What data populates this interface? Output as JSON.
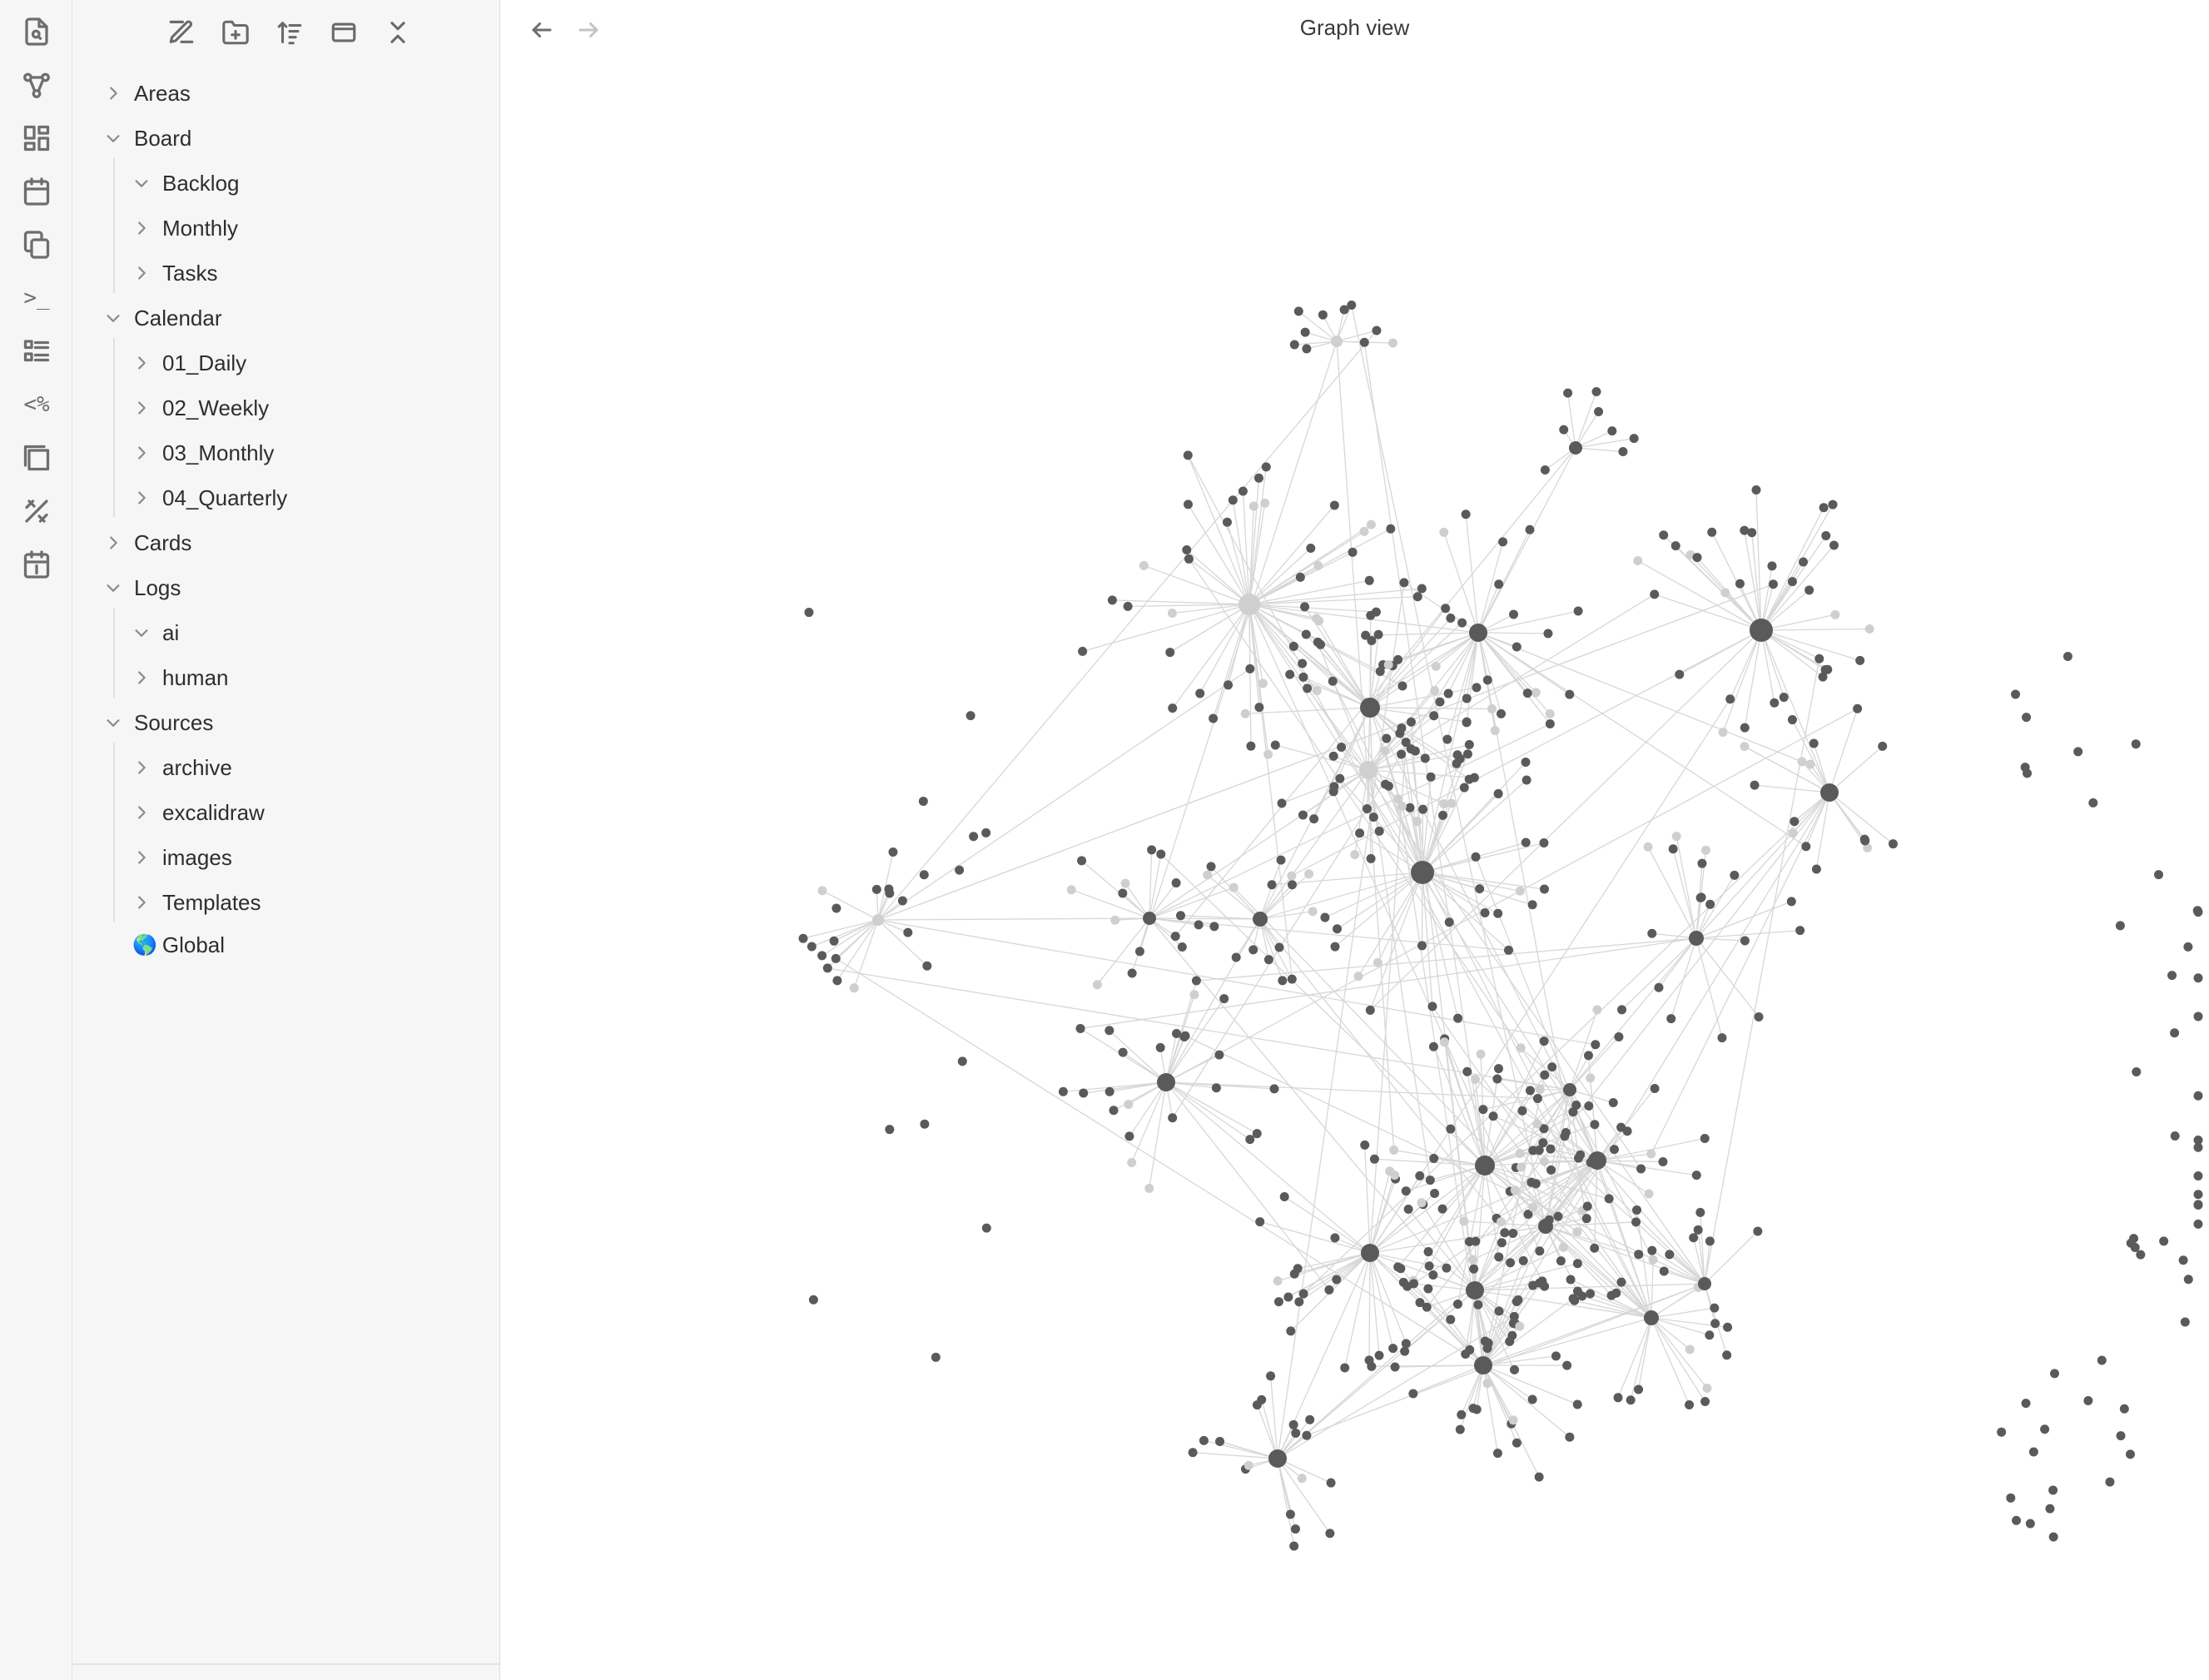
{
  "ribbon": {
    "icons": [
      "search-file-icon",
      "graph-icon",
      "dashboard-icon",
      "calendar-icon",
      "copy-icon",
      "terminal-icon",
      "list-icon",
      "templater-icon",
      "stack-icon",
      "excalidraw-icon",
      "daily-note-icon"
    ],
    "templater_glyph": "<%",
    "terminal_glyph": ">_"
  },
  "sidebar": {
    "toolbar": [
      "new-note-icon",
      "new-folder-icon",
      "sort-icon",
      "auto-reveal-icon",
      "collapse-all-icon"
    ],
    "tree": [
      {
        "label": "Areas",
        "expanded": false,
        "depth": 0
      },
      {
        "label": "Board",
        "expanded": true,
        "depth": 0
      },
      {
        "label": "Backlog",
        "expanded": true,
        "depth": 1
      },
      {
        "label": "Monthly",
        "expanded": false,
        "depth": 1
      },
      {
        "label": "Tasks",
        "expanded": false,
        "depth": 1
      },
      {
        "label": "Calendar",
        "expanded": true,
        "depth": 0
      },
      {
        "label": "01_Daily",
        "expanded": false,
        "depth": 1
      },
      {
        "label": "02_Weekly",
        "expanded": false,
        "depth": 1
      },
      {
        "label": "03_Monthly",
        "expanded": false,
        "depth": 1
      },
      {
        "label": "04_Quarterly",
        "expanded": false,
        "depth": 1
      },
      {
        "label": "Cards",
        "expanded": false,
        "depth": 0
      },
      {
        "label": "Logs",
        "expanded": true,
        "depth": 0
      },
      {
        "label": "ai",
        "expanded": true,
        "depth": 1
      },
      {
        "label": "human",
        "expanded": false,
        "depth": 1
      },
      {
        "label": "Sources",
        "expanded": true,
        "depth": 0
      },
      {
        "label": "archive",
        "expanded": false,
        "depth": 1
      },
      {
        "label": "excalidraw",
        "expanded": false,
        "depth": 1
      },
      {
        "label": "images",
        "expanded": false,
        "depth": 1
      },
      {
        "label": "Templates",
        "expanded": false,
        "depth": 1
      }
    ],
    "global_label": "Global",
    "global_emoji": "🌎"
  },
  "main": {
    "title": "Graph view",
    "back_icon": "arrow-left-icon",
    "forward_icon": "arrow-right-icon"
  },
  "colors": {
    "node_dark": "#5a5a5a",
    "node_light": "#cfcfcf",
    "edge": "#d7d7d7",
    "sidebar_bg": "#f6f6f6"
  }
}
